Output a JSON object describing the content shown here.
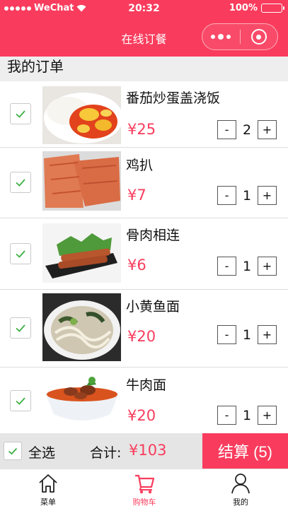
{
  "status_bar": {
    "carrier": "WeChat",
    "time": "20:32",
    "battery": "100%",
    "battery_level": 1.0
  },
  "nav": {
    "title": "在线订餐"
  },
  "section": {
    "title": "我的订单"
  },
  "orders": [
    {
      "name": "番茄炒蛋盖浇饭",
      "price": "¥25",
      "quantity": "2",
      "checked": true,
      "image": "tomato-egg-rice"
    },
    {
      "name": "鸡扒",
      "price": "¥7",
      "quantity": "1",
      "checked": true,
      "image": "chicken-steak"
    },
    {
      "name": "骨肉相连",
      "price": "¥6",
      "quantity": "1",
      "checked": true,
      "image": "meat-skewers"
    },
    {
      "name": "小黄鱼面",
      "price": "¥20",
      "quantity": "1",
      "checked": true,
      "image": "yellow-fish-noodles"
    },
    {
      "name": "牛肉面",
      "price": "¥20",
      "quantity": "1",
      "checked": true,
      "image": "beef-noodles"
    }
  ],
  "stepper": {
    "minus_label": "-",
    "plus_label": "+"
  },
  "checkout_bar": {
    "select_all_label": "全选",
    "total_label": "合计:",
    "total_value": "¥103",
    "checkout_label": "结算 (5)"
  },
  "tab_bar": {
    "tabs": [
      {
        "label": "菜单",
        "icon": "house-icon",
        "active": false
      },
      {
        "label": "购物车",
        "icon": "cart-icon",
        "active": true
      },
      {
        "label": "我的",
        "icon": "person-icon",
        "active": false
      }
    ]
  },
  "colors": {
    "brand": "#f93c5d",
    "check": "#3cb043",
    "bar_bg": "#e5e5e5"
  }
}
